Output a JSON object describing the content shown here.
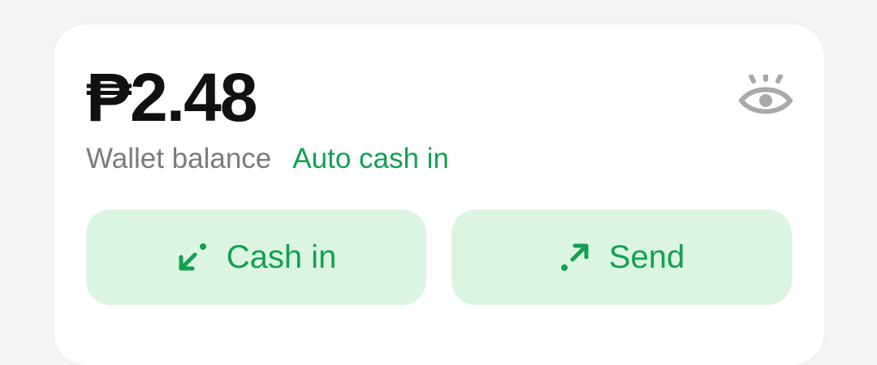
{
  "wallet": {
    "amount": "₱2.48",
    "balance_label": "Wallet balance",
    "auto_cash_in_label": "Auto cash in",
    "visibility_icon": "eye-icon"
  },
  "actions": {
    "cash_in": {
      "label": "Cash in",
      "icon": "arrow-down-left-icon"
    },
    "send": {
      "label": "Send",
      "icon": "arrow-up-right-icon"
    }
  },
  "colors": {
    "accent": "#13a051",
    "button_bg": "#dcf5e2",
    "muted_text": "#7b7b7b",
    "amount_text": "#111111",
    "icon_gray": "#a9a9a9"
  }
}
